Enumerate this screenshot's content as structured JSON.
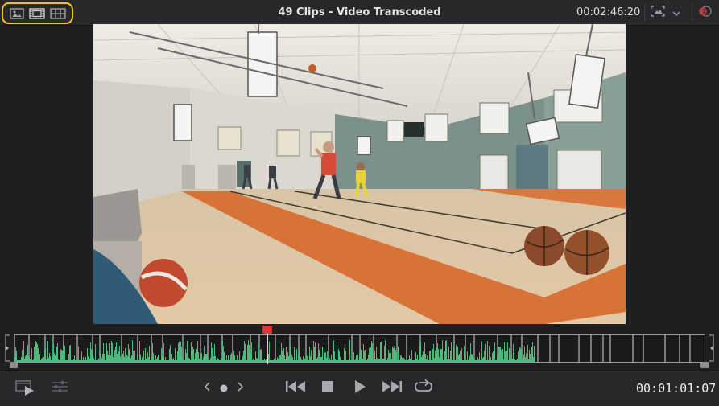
{
  "header": {
    "title": "49 Clips - Video Transcoded",
    "timecode": "00:02:46:20"
  },
  "toolbar": {
    "view_modes": [
      {
        "icon": "single-viewer-icon"
      },
      {
        "icon": "dual-viewer-icon"
      },
      {
        "icon": "clip-grid-icon"
      }
    ],
    "viewer_options_icon": "viewer-options-icon",
    "viewer_menu_icon": "chevron-down-icon",
    "fx_icon": "fx-bypass-icon"
  },
  "viewer": {
    "subject": "basketball-gym-frame"
  },
  "scrubber": {
    "playhead_position": 0.367,
    "audio_extent": 0.755,
    "playhead_color": "#e0343a",
    "waveform_color": "#4fb87a"
  },
  "transport": {
    "timecode": "00:01:01:07",
    "buttons": [
      {
        "name": "clip-viewer-icon"
      },
      {
        "name": "adjust-clip-icon"
      },
      {
        "name": "previous-clip-icon"
      },
      {
        "name": "dot-icon"
      },
      {
        "name": "next-clip-icon"
      },
      {
        "name": "jump-to-start-icon"
      },
      {
        "name": "stop-icon"
      },
      {
        "name": "play-icon"
      },
      {
        "name": "jump-to-end-icon"
      },
      {
        "name": "loop-icon"
      }
    ]
  }
}
